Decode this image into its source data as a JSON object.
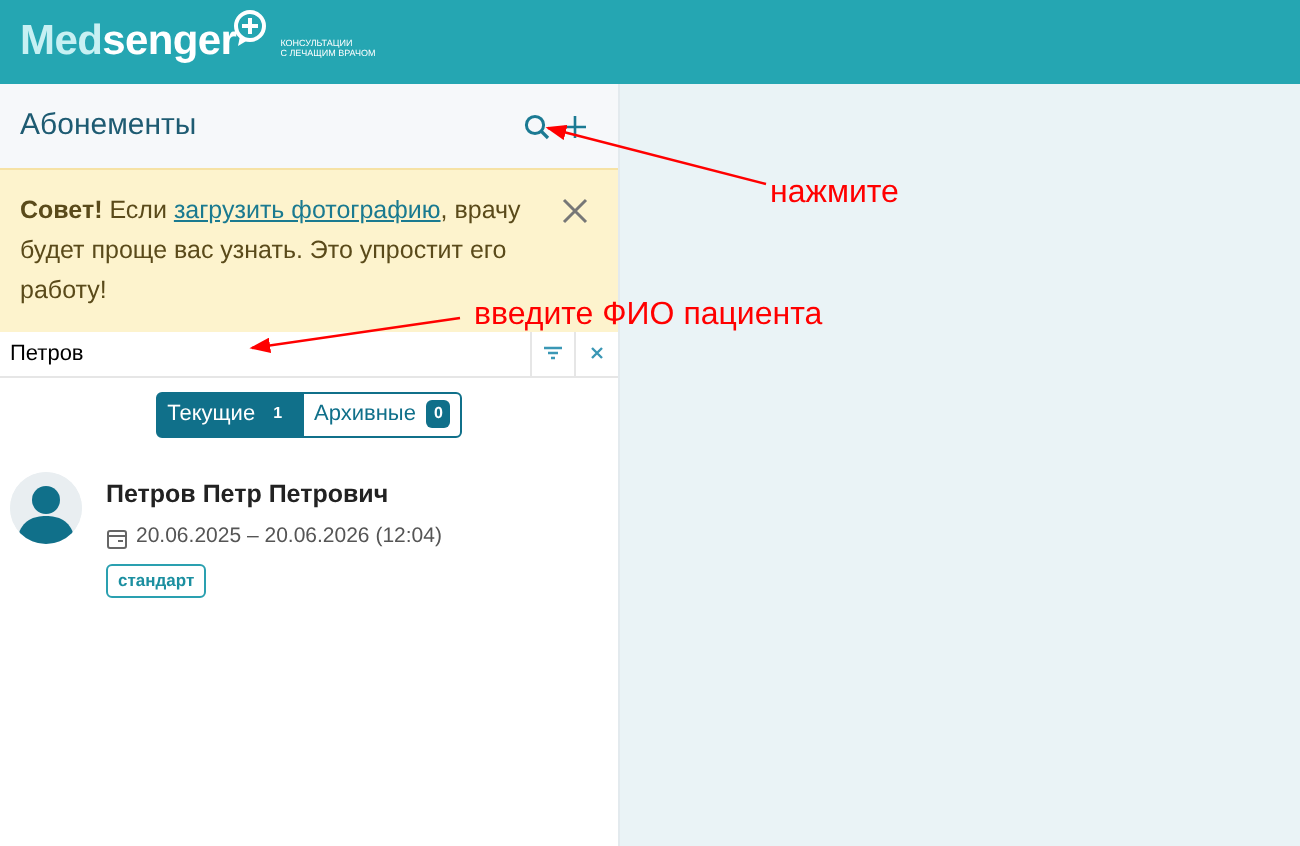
{
  "header": {
    "logo_text": "Medsenger",
    "logo_subtitle": [
      "КОНСУЛЬТАЦИИ",
      "С ЛЕЧАЩИМ ВРАЧОМ"
    ]
  },
  "panel": {
    "title": "Абонементы"
  },
  "tip": {
    "text": "**Совет!** Если ",
    "link": "загрузить фотографию",
    "rest": ", врачу будет проще вас узнать. Это упростит его работу!"
  },
  "search": {
    "value": "Петров"
  },
  "tabs": [
    {
      "label": "Текущие",
      "count": "1",
      "selected": true
    },
    {
      "label": "Архивные",
      "count": "0",
      "selected": false
    }
  ],
  "patients": [
    {
      "name": "Петров Петр Петрович",
      "period": "20.06.2025 – 20.06.2026 (12:04)",
      "tag": "стандарт"
    }
  ],
  "annotations": [
    {
      "text": "нажмите"
    },
    {
      "text": "введите ФИО пациента"
    }
  ]
}
